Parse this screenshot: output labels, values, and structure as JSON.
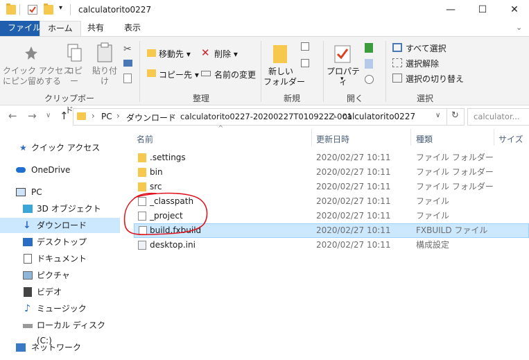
{
  "window": {
    "title": "calculatorito0227",
    "minimize": "—",
    "maximize": "☐",
    "close": "✕"
  },
  "tabs": [
    "ファイル",
    "ホーム",
    "共有",
    "表示"
  ],
  "ribbon": {
    "clipboard": {
      "pin_label": "クイック アクセス\nにピン留めする",
      "copy_label": "コピー",
      "paste_label": "貼り付け",
      "group_label": "クリップボード"
    },
    "organize": {
      "move_to": "移動先",
      "copy_to": "コピー先",
      "delete": "削除",
      "rename": "名前の変更",
      "group_label": "整理"
    },
    "new": {
      "new_folder": "新しい\nフォルダー",
      "group_label": "新規"
    },
    "open": {
      "properties": "プロパティ",
      "group_label": "開く"
    },
    "select": {
      "select_all": "すべて選択",
      "select_none": "選択解除",
      "invert": "選択の切り替え",
      "group_label": "選択"
    }
  },
  "address": {
    "crumbs": [
      "PC",
      "ダウンロード",
      "calculatorito0227-20200227T010922Z-001",
      "calculatorito0227"
    ],
    "search_placeholder": "calculator..."
  },
  "nav": [
    {
      "label": "クイック アクセス",
      "icon": "star-icon"
    },
    {
      "label": "OneDrive",
      "icon": "cloud-icon"
    },
    {
      "label": "PC",
      "icon": "pc-icon"
    },
    {
      "label": "3D オブジェクト",
      "icon": "cube-icon"
    },
    {
      "label": "ダウンロード",
      "icon": "download-icon"
    },
    {
      "label": "デスクトップ",
      "icon": "desktop-icon"
    },
    {
      "label": "ドキュメント",
      "icon": "document-icon"
    },
    {
      "label": "ピクチャ",
      "icon": "picture-icon"
    },
    {
      "label": "ビデオ",
      "icon": "video-icon"
    },
    {
      "label": "ミュージック",
      "icon": "music-icon"
    },
    {
      "label": "ローカル ディスク (C:)",
      "icon": "disk-icon"
    },
    {
      "label": "ネットワーク",
      "icon": "network-icon"
    }
  ],
  "columns": {
    "name": "名前",
    "date": "更新日時",
    "type": "種類",
    "size": "サイズ"
  },
  "files": [
    {
      "name": ".settings",
      "date": "2020/02/27 10:11",
      "type": "ファイル フォルダー"
    },
    {
      "name": "bin",
      "date": "2020/02/27 10:11",
      "type": "ファイル フォルダー"
    },
    {
      "name": "src",
      "date": "2020/02/27 10:11",
      "type": "ファイル フォルダー"
    },
    {
      "name": "_classpath",
      "date": "2020/02/27 10:11",
      "type": "ファイル"
    },
    {
      "name": "_project",
      "date": "2020/02/27 10:11",
      "type": "ファイル"
    },
    {
      "name": "build.fxbuild",
      "date": "2020/02/27 10:11",
      "type": "FXBUILD ファイル"
    },
    {
      "name": "desktop.ini",
      "date": "2020/02/27 10:11",
      "type": "構成設定"
    }
  ],
  "colors": {
    "accent": "#1f5fae",
    "selection": "#cce8ff",
    "annotation": "#e0141e"
  }
}
